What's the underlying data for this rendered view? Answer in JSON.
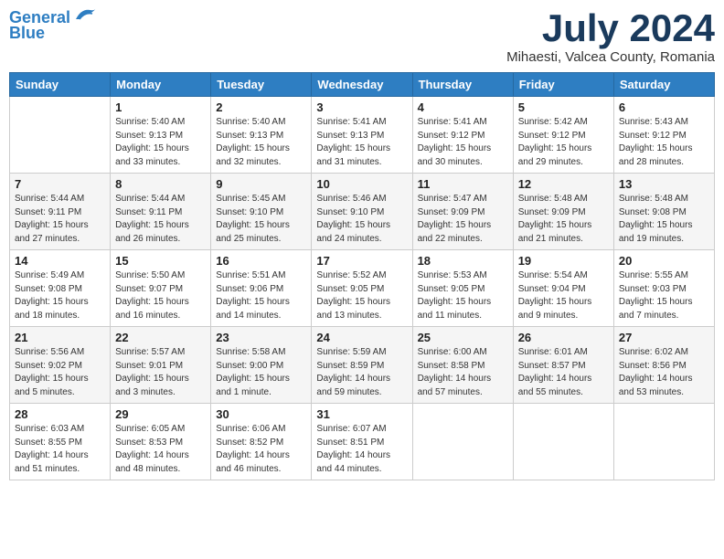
{
  "header": {
    "logo_line1": "General",
    "logo_line2": "Blue",
    "month": "July 2024",
    "location": "Mihaesti, Valcea County, Romania"
  },
  "days_of_week": [
    "Sunday",
    "Monday",
    "Tuesday",
    "Wednesday",
    "Thursday",
    "Friday",
    "Saturday"
  ],
  "weeks": [
    [
      {
        "num": "",
        "info": ""
      },
      {
        "num": "1",
        "info": "Sunrise: 5:40 AM\nSunset: 9:13 PM\nDaylight: 15 hours\nand 33 minutes."
      },
      {
        "num": "2",
        "info": "Sunrise: 5:40 AM\nSunset: 9:13 PM\nDaylight: 15 hours\nand 32 minutes."
      },
      {
        "num": "3",
        "info": "Sunrise: 5:41 AM\nSunset: 9:13 PM\nDaylight: 15 hours\nand 31 minutes."
      },
      {
        "num": "4",
        "info": "Sunrise: 5:41 AM\nSunset: 9:12 PM\nDaylight: 15 hours\nand 30 minutes."
      },
      {
        "num": "5",
        "info": "Sunrise: 5:42 AM\nSunset: 9:12 PM\nDaylight: 15 hours\nand 29 minutes."
      },
      {
        "num": "6",
        "info": "Sunrise: 5:43 AM\nSunset: 9:12 PM\nDaylight: 15 hours\nand 28 minutes."
      }
    ],
    [
      {
        "num": "7",
        "info": "Sunrise: 5:44 AM\nSunset: 9:11 PM\nDaylight: 15 hours\nand 27 minutes."
      },
      {
        "num": "8",
        "info": "Sunrise: 5:44 AM\nSunset: 9:11 PM\nDaylight: 15 hours\nand 26 minutes."
      },
      {
        "num": "9",
        "info": "Sunrise: 5:45 AM\nSunset: 9:10 PM\nDaylight: 15 hours\nand 25 minutes."
      },
      {
        "num": "10",
        "info": "Sunrise: 5:46 AM\nSunset: 9:10 PM\nDaylight: 15 hours\nand 24 minutes."
      },
      {
        "num": "11",
        "info": "Sunrise: 5:47 AM\nSunset: 9:09 PM\nDaylight: 15 hours\nand 22 minutes."
      },
      {
        "num": "12",
        "info": "Sunrise: 5:48 AM\nSunset: 9:09 PM\nDaylight: 15 hours\nand 21 minutes."
      },
      {
        "num": "13",
        "info": "Sunrise: 5:48 AM\nSunset: 9:08 PM\nDaylight: 15 hours\nand 19 minutes."
      }
    ],
    [
      {
        "num": "14",
        "info": "Sunrise: 5:49 AM\nSunset: 9:08 PM\nDaylight: 15 hours\nand 18 minutes."
      },
      {
        "num": "15",
        "info": "Sunrise: 5:50 AM\nSunset: 9:07 PM\nDaylight: 15 hours\nand 16 minutes."
      },
      {
        "num": "16",
        "info": "Sunrise: 5:51 AM\nSunset: 9:06 PM\nDaylight: 15 hours\nand 14 minutes."
      },
      {
        "num": "17",
        "info": "Sunrise: 5:52 AM\nSunset: 9:05 PM\nDaylight: 15 hours\nand 13 minutes."
      },
      {
        "num": "18",
        "info": "Sunrise: 5:53 AM\nSunset: 9:05 PM\nDaylight: 15 hours\nand 11 minutes."
      },
      {
        "num": "19",
        "info": "Sunrise: 5:54 AM\nSunset: 9:04 PM\nDaylight: 15 hours\nand 9 minutes."
      },
      {
        "num": "20",
        "info": "Sunrise: 5:55 AM\nSunset: 9:03 PM\nDaylight: 15 hours\nand 7 minutes."
      }
    ],
    [
      {
        "num": "21",
        "info": "Sunrise: 5:56 AM\nSunset: 9:02 PM\nDaylight: 15 hours\nand 5 minutes."
      },
      {
        "num": "22",
        "info": "Sunrise: 5:57 AM\nSunset: 9:01 PM\nDaylight: 15 hours\nand 3 minutes."
      },
      {
        "num": "23",
        "info": "Sunrise: 5:58 AM\nSunset: 9:00 PM\nDaylight: 15 hours\nand 1 minute."
      },
      {
        "num": "24",
        "info": "Sunrise: 5:59 AM\nSunset: 8:59 PM\nDaylight: 14 hours\nand 59 minutes."
      },
      {
        "num": "25",
        "info": "Sunrise: 6:00 AM\nSunset: 8:58 PM\nDaylight: 14 hours\nand 57 minutes."
      },
      {
        "num": "26",
        "info": "Sunrise: 6:01 AM\nSunset: 8:57 PM\nDaylight: 14 hours\nand 55 minutes."
      },
      {
        "num": "27",
        "info": "Sunrise: 6:02 AM\nSunset: 8:56 PM\nDaylight: 14 hours\nand 53 minutes."
      }
    ],
    [
      {
        "num": "28",
        "info": "Sunrise: 6:03 AM\nSunset: 8:55 PM\nDaylight: 14 hours\nand 51 minutes."
      },
      {
        "num": "29",
        "info": "Sunrise: 6:05 AM\nSunset: 8:53 PM\nDaylight: 14 hours\nand 48 minutes."
      },
      {
        "num": "30",
        "info": "Sunrise: 6:06 AM\nSunset: 8:52 PM\nDaylight: 14 hours\nand 46 minutes."
      },
      {
        "num": "31",
        "info": "Sunrise: 6:07 AM\nSunset: 8:51 PM\nDaylight: 14 hours\nand 44 minutes."
      },
      {
        "num": "",
        "info": ""
      },
      {
        "num": "",
        "info": ""
      },
      {
        "num": "",
        "info": ""
      }
    ]
  ]
}
